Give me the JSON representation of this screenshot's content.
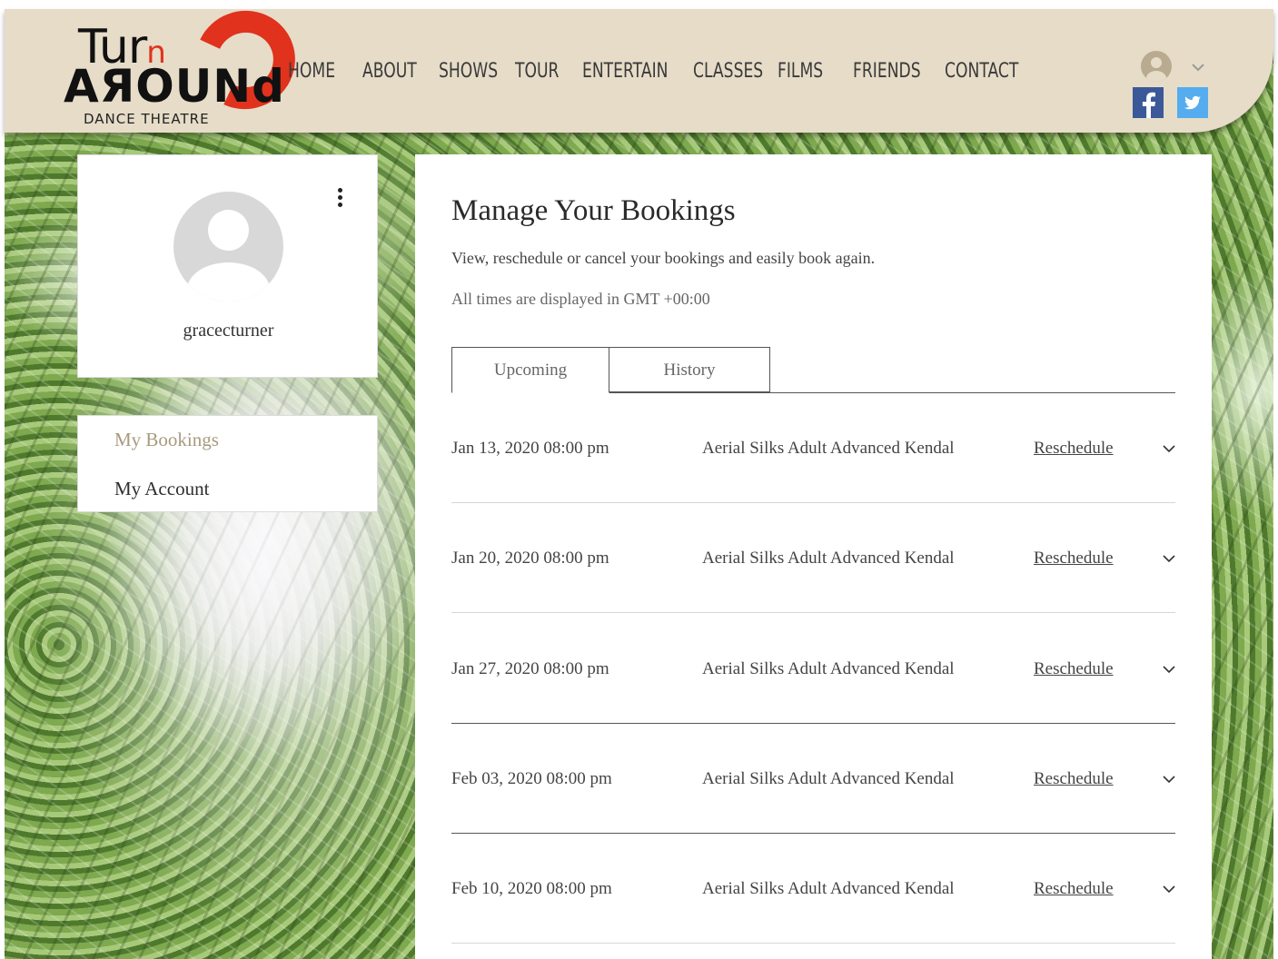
{
  "brand": {
    "logo_top": "Tur",
    "logo_n": "n",
    "logo_main": "AЯOUNd",
    "logo_sub": "DANCE THEATRE"
  },
  "nav": {
    "items": [
      "Home",
      "About",
      "Shows",
      "Tour",
      "Entertain",
      "Classes",
      "Films",
      "Friends",
      "Contact"
    ]
  },
  "social": {
    "facebook": "facebook-icon",
    "twitter": "twitter-icon"
  },
  "profile": {
    "username": "gracecturner"
  },
  "side_menu": {
    "items": [
      {
        "label": "My Bookings",
        "active": true
      },
      {
        "label": "My Account",
        "active": false
      }
    ]
  },
  "main": {
    "title": "Manage Your Bookings",
    "subtitle": "View, reschedule or cancel your bookings and easily book again.",
    "timezone": "All times are displayed in GMT +00:00",
    "tabs": [
      {
        "label": "Upcoming",
        "active": true
      },
      {
        "label": "History",
        "active": false
      }
    ],
    "bookings": [
      {
        "date": "Jan 13, 2020 08:00 pm",
        "service": "Aerial Silks Adult Advanced Kendal",
        "action": "Reschedule"
      },
      {
        "date": "Jan 20, 2020 08:00 pm",
        "service": "Aerial Silks Adult Advanced Kendal",
        "action": "Reschedule"
      },
      {
        "date": "Jan 27, 2020 08:00 pm",
        "service": "Aerial Silks Adult Advanced Kendal",
        "action": "Reschedule"
      },
      {
        "date": "Feb 03, 2020 08:00 pm",
        "service": "Aerial Silks Adult Advanced Kendal",
        "action": "Reschedule"
      },
      {
        "date": "Feb 10, 2020 08:00 pm",
        "service": "Aerial Silks Adult Advanced Kendal",
        "action": "Reschedule"
      }
    ]
  },
  "colors": {
    "header_bg": "#e6dcc8",
    "logo_red": "#e0321c",
    "active_menu": "#a99a7e",
    "facebook": "#3b5998",
    "twitter": "#55acee"
  }
}
